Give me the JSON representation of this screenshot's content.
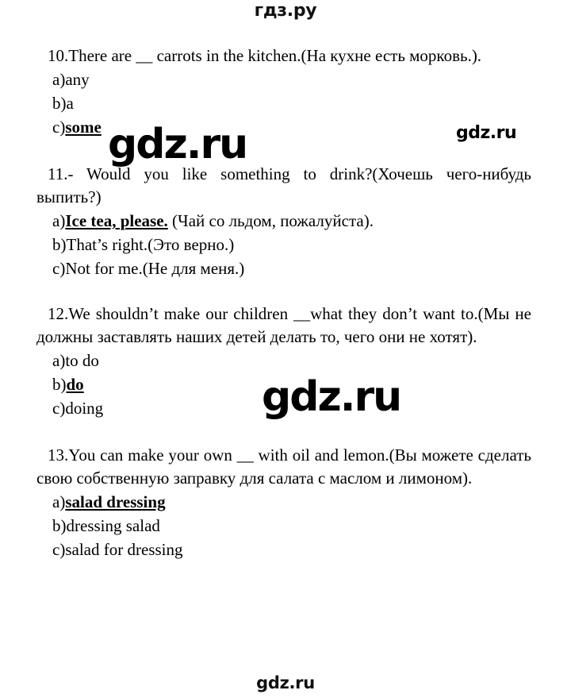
{
  "header": {
    "logo": "гдз.ру"
  },
  "footer": {
    "logo": "gdz.ru"
  },
  "watermarks": [
    {
      "text": "gdz.ru",
      "size": "large"
    },
    {
      "text": "gdz.ru",
      "size": "small"
    },
    {
      "text": "gdz.ru",
      "size": "large"
    }
  ],
  "questions": [
    {
      "number": "10.",
      "prompt": "There are __ carrots in the kitchen.(На кухне есть морковь.).",
      "options": [
        {
          "marker": "a)",
          "text": "any",
          "correct": false,
          "translation": ""
        },
        {
          "marker": "b)",
          "text": "a",
          "correct": false,
          "translation": ""
        },
        {
          "marker": "c)",
          "text": "some",
          "correct": true,
          "translation": ""
        }
      ]
    },
    {
      "number": "11.",
      "prompt": "- Would you like something to drink?(Хочешь чего-нибудь выпить?)",
      "options": [
        {
          "marker": "a)",
          "text": "Ice tea, please.",
          "correct": true,
          "translation": " (Чай со льдом, пожалуйста)."
        },
        {
          "marker": "b)",
          "text": "That’s right.",
          "correct": false,
          "translation": "(Это верно.)"
        },
        {
          "marker": "c)",
          "text": "Not for me.",
          "correct": false,
          "translation": "(Не для меня.)"
        }
      ]
    },
    {
      "number": "12.",
      "prompt": "We shouldn’t make our children __what they don’t want to.(Мы не должны заставлять наших детей делать то, чего они не хотят).",
      "options": [
        {
          "marker": "a)",
          "text": "to do",
          "correct": false,
          "translation": ""
        },
        {
          "marker": "b)",
          "text": "do",
          "correct": true,
          "translation": ""
        },
        {
          "marker": "c)",
          "text": "doing",
          "correct": false,
          "translation": ""
        }
      ]
    },
    {
      "number": "13.",
      "prompt": "You can make your own __ with oil and lemon.(Вы можете сделать свою собственную заправку для салата с маслом и лимоном).",
      "options": [
        {
          "marker": "a)",
          "text": "salad dressing",
          "correct": true,
          "translation": ""
        },
        {
          "marker": "b)",
          "text": "dressing salad",
          "correct": false,
          "translation": ""
        },
        {
          "marker": "c)",
          "text": "salad for dressing",
          "correct": false,
          "translation": ""
        }
      ]
    }
  ]
}
